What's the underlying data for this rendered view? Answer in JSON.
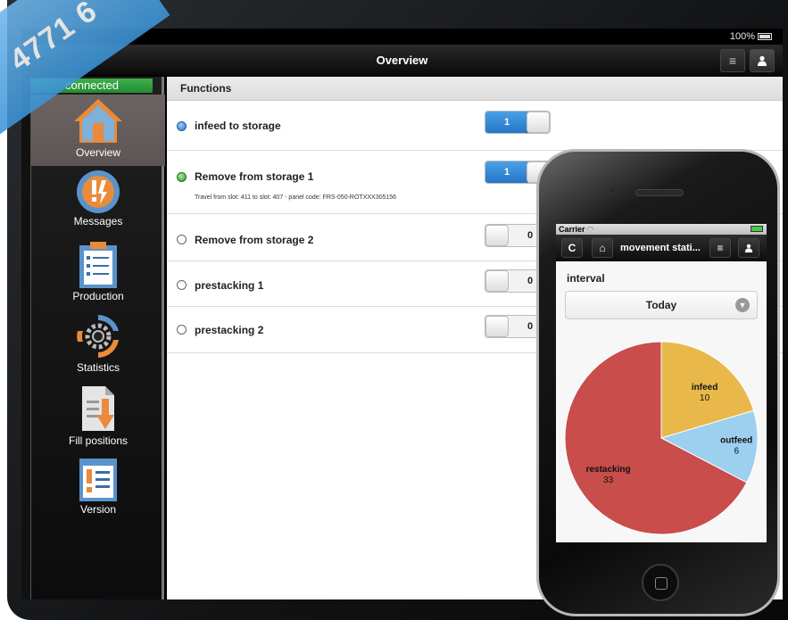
{
  "status_bar": {
    "battery": "100%"
  },
  "header": {
    "title": "Overview"
  },
  "sidebar": {
    "connection": "connected",
    "items": [
      {
        "label": "Overview",
        "icon": "home-icon",
        "active": true
      },
      {
        "label": "Messages",
        "icon": "messages-icon"
      },
      {
        "label": "Production",
        "icon": "clipboard-icon"
      },
      {
        "label": "Statistics",
        "icon": "statistics-icon"
      },
      {
        "label": "Fill positions",
        "icon": "fill-positions-icon"
      },
      {
        "label": "Version",
        "icon": "version-icon"
      }
    ]
  },
  "functions": {
    "header": "Functions",
    "rows": [
      {
        "title": "infeed to storage",
        "status": "blue",
        "toggle": "1"
      },
      {
        "title": "Remove from storage 1",
        "status": "green",
        "toggle": "1",
        "detail": "Travel from slot: 411 to slot: 407 - panel code: FRS-050-ROTXXX305156"
      },
      {
        "title": "Remove from storage 2",
        "status": "off",
        "toggle": "0"
      },
      {
        "title": "prestacking 1",
        "status": "off",
        "toggle": "0"
      },
      {
        "title": "prestacking 2",
        "status": "off",
        "toggle": "0"
      }
    ]
  },
  "phone": {
    "carrier": "Carrier",
    "title": "movement stati...",
    "interval_label": "interval",
    "interval_value": "Today"
  },
  "chart_data": {
    "type": "pie",
    "slices": [
      {
        "label": "infeed",
        "value": 10,
        "color": "#e8b84a"
      },
      {
        "label": "outfeed",
        "value": 6,
        "color": "#9dcfef"
      },
      {
        "label": "restacking",
        "value": 33,
        "color": "#c84d4b"
      }
    ]
  },
  "watermark": {
    "text": "4771 6"
  }
}
